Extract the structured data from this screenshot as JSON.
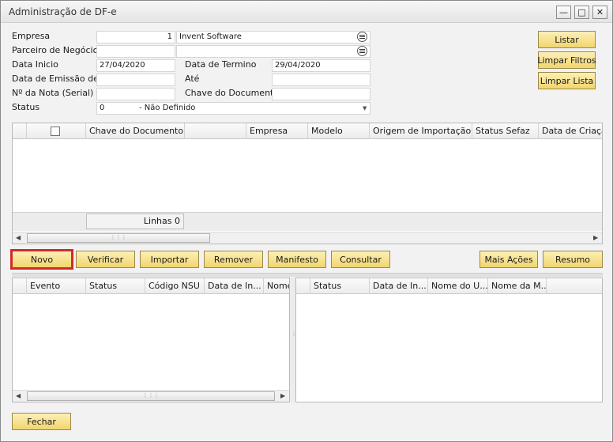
{
  "window": {
    "title": "Administração de DF-e"
  },
  "form": {
    "empresa_label": "Empresa",
    "empresa_code": "1",
    "empresa_name": "Invent Software",
    "parceiro_label": "Parceiro de Negócios",
    "parceiro_code": "",
    "parceiro_name": "",
    "data_inicio_label": "Data Inicio",
    "data_inicio_value": "27/04/2020",
    "data_termino_label": "Data de Termino",
    "data_termino_value": "29/04/2020",
    "data_emissao_label": "Data de Emissão de",
    "data_emissao_value": "",
    "ate_label": "Até",
    "ate_value": "",
    "num_nota_label": "Nº da Nota (Serial)",
    "num_nota_value": "",
    "chave_label": "Chave do Documento",
    "chave_value": "",
    "status_label": "Status",
    "status_code": "0",
    "status_text": "- Não Definido"
  },
  "side_buttons": {
    "listar": "Listar",
    "limpar_filtros": "Limpar Filtros",
    "limpar_lista": "Limpar Lista"
  },
  "main_grid": {
    "columns": [
      "Chave do Documento",
      "Empresa",
      "Modelo",
      "Origem de Importação",
      "Status Sefaz",
      "Data de Criação"
    ],
    "rows_label": "Linhas 0"
  },
  "action_buttons": {
    "novo": "Novo",
    "verificar": "Verificar",
    "importar": "Importar",
    "remover": "Remover",
    "manifesto": "Manifesto",
    "consultar": "Consultar",
    "mais_acoes": "Mais Ações",
    "resumo": "Resumo"
  },
  "events_grid": {
    "columns": [
      "Evento",
      "Status",
      "Código NSU",
      "Data de In...",
      "Nome"
    ]
  },
  "right_grid": {
    "columns": [
      "Status",
      "Data de In...",
      "Nome do U...",
      "Nome da M..."
    ]
  },
  "footer": {
    "fechar": "Fechar"
  },
  "colors": {
    "button_fill": "#f1d56d",
    "selected_outline": "#d22a2a"
  }
}
